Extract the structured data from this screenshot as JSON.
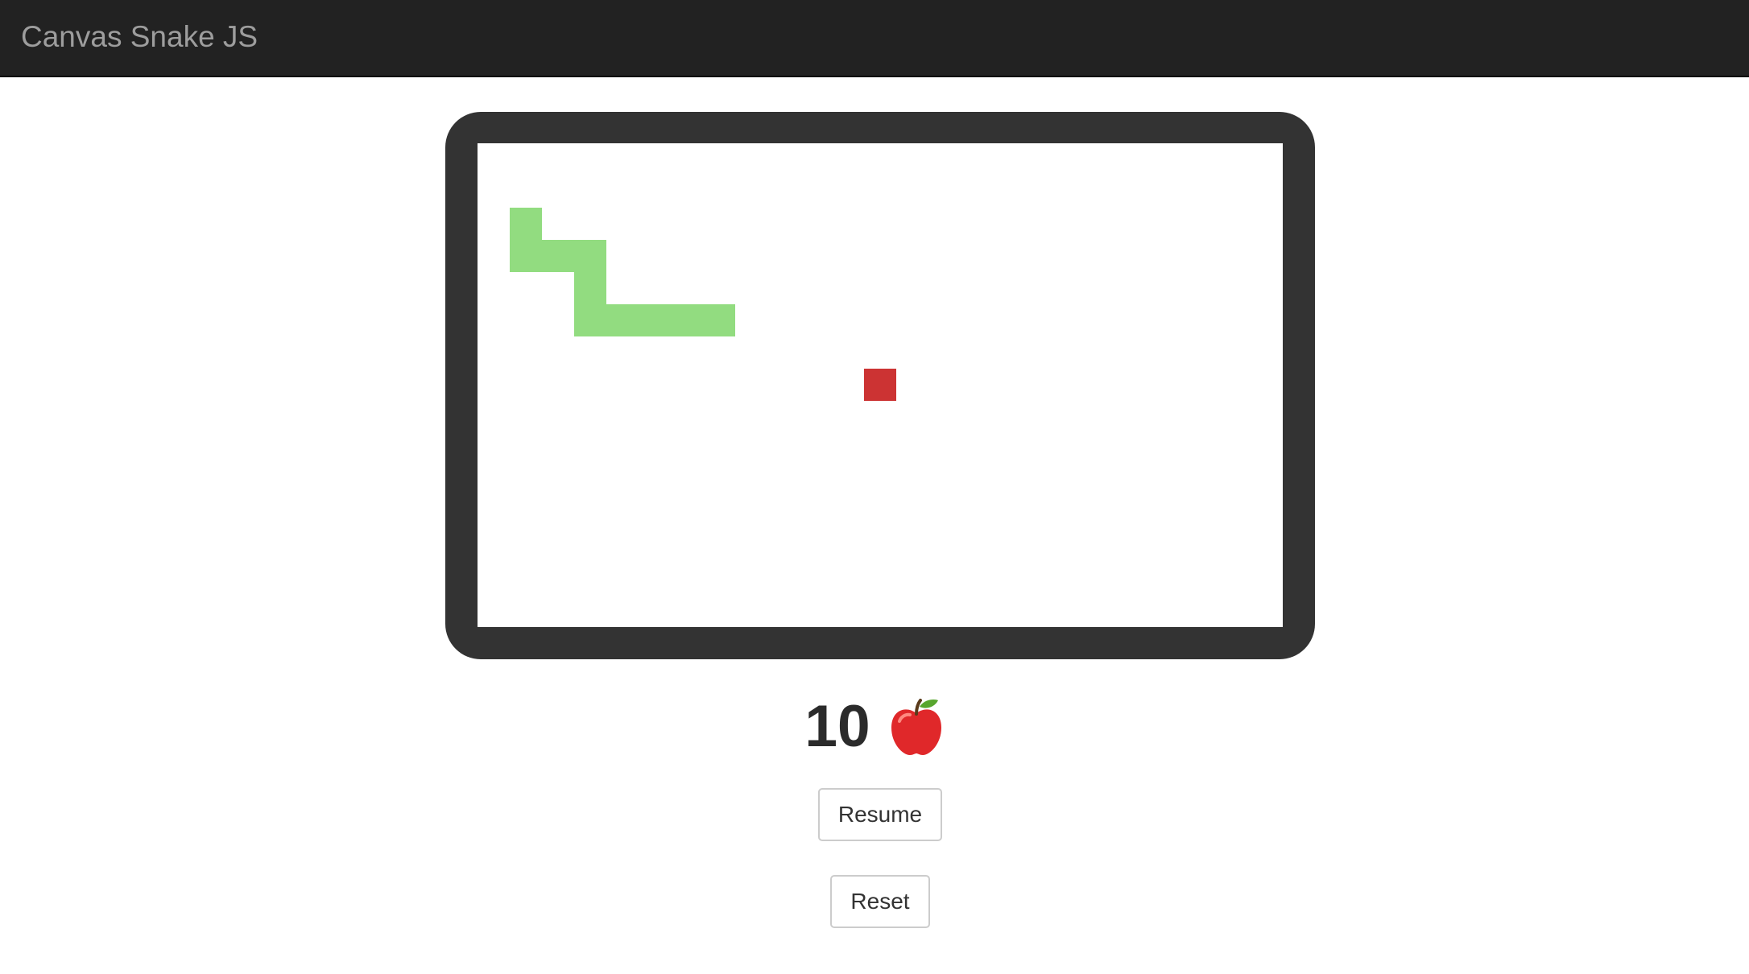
{
  "navbar": {
    "brand": "Canvas Snake JS",
    "background": "#222222",
    "brand_color": "#9d9d9d"
  },
  "board": {
    "frame_color": "#333333",
    "field_color": "#ffffff",
    "snake_color": "#92dc80",
    "food_color": "#cc3333",
    "cell": 40,
    "cols": 25,
    "rows": 15,
    "snake": [
      {
        "col": 7,
        "row": 5
      },
      {
        "col": 6,
        "row": 5
      },
      {
        "col": 5,
        "row": 5
      },
      {
        "col": 4,
        "row": 5
      },
      {
        "col": 3,
        "row": 5
      },
      {
        "col": 3,
        "row": 4
      },
      {
        "col": 3,
        "row": 3
      },
      {
        "col": 2,
        "row": 3
      },
      {
        "col": 1,
        "row": 3
      },
      {
        "col": 1,
        "row": 2
      }
    ],
    "food": {
      "col": 12,
      "row": 7
    }
  },
  "score": {
    "value": "10",
    "icon": "apple-icon"
  },
  "buttons": {
    "resume": "Resume",
    "reset": "Reset"
  }
}
